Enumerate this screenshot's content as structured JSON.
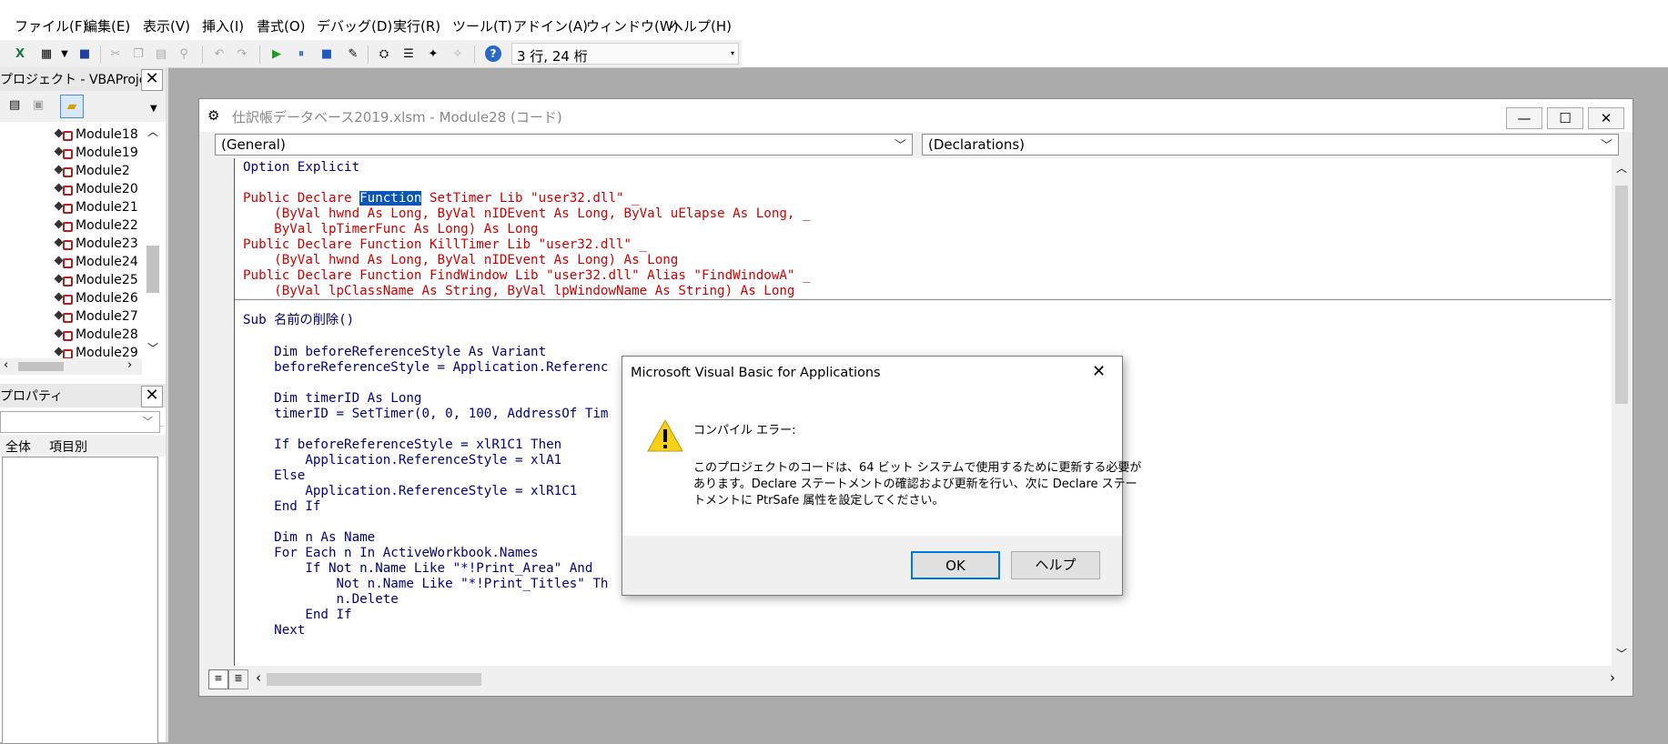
{
  "menu": [
    "ファイル(F)",
    "編集(E)",
    "表示(V)",
    "挿入(I)",
    "書式(O)",
    "デバッグ(D)",
    "実行(R)",
    "ツール(T)",
    "アドイン(A)",
    "ウィンドウ(W)",
    "ヘルプ(H)"
  ],
  "toolbar": {
    "cursor_position": "3 行, 24 桁"
  },
  "project_panel": {
    "title": "プロジェクト - VBAProject",
    "modules": [
      "Module18",
      "Module19",
      "Module2",
      "Module20",
      "Module21",
      "Module22",
      "Module23",
      "Module24",
      "Module25",
      "Module26",
      "Module27",
      "Module28",
      "Module29"
    ]
  },
  "properties_panel": {
    "title": "プロパティ",
    "tabs": [
      "全体",
      "項目別"
    ]
  },
  "code_window": {
    "title": "仕訳帳データベース2019.xlsm - Module28 (コード)",
    "object_combo": "(General)",
    "procedure_combo": "(Declarations)"
  },
  "code": {
    "l1": "Option Explicit",
    "l2_a": "Public Declare ",
    "l2_hl": "Function",
    "l2_b": " SetTimer Lib \"user32.dll\" _",
    "l3": "    (ByVal hwnd As Long, ByVal nIDEvent As Long, ByVal uElapse As Long, _",
    "l4": "    ByVal lpTimerFunc As Long) As Long",
    "l5": "Public Declare Function KillTimer Lib \"user32.dll\" _",
    "l6": "    (ByVal hwnd As Long, ByVal nIDEvent As Long) As Long",
    "l7": "Public Declare Function FindWindow Lib \"user32.dll\" Alias \"FindWindowA\" _",
    "l8": "    (ByVal lpClassName As String, ByVal lpWindowName As String) As Long",
    "l9": "Sub 名前の削除()",
    "l10": "    Dim beforeReferenceStyle As Variant",
    "l11": "    beforeReferenceStyle = Application.Referenc",
    "l12": "    Dim timerID As Long",
    "l13": "    timerID = SetTimer(0, 0, 100, AddressOf Tim",
    "l14": "    If beforeReferenceStyle = xlR1C1 Then",
    "l15": "        Application.ReferenceStyle = xlA1",
    "l16": "    Else",
    "l17": "        Application.ReferenceStyle = xlR1C1",
    "l18": "    End If",
    "l19": "    Dim n As Name",
    "l20": "    For Each n In ActiveWorkbook.Names",
    "l21": "        If Not n.Name Like \"*!Print_Area\" And",
    "l22": "            Not n.Name Like \"*!Print_Titles\" Th",
    "l23": "            n.Delete",
    "l24": "        End If",
    "l25": "    Next"
  },
  "dialog": {
    "title": "Microsoft Visual Basic for Applications",
    "heading": "コンパイル エラー:",
    "message_1": "このプロジェクトのコードは、64 ビット システムで使用するために更新する必要が",
    "message_2": "あります。Declare ステートメントの確認および更新を行い、次に Declare ステー",
    "message_3": "トメントに PtrSafe 属性を設定してください。",
    "ok_label": "OK",
    "help_label": "ヘルプ"
  },
  "colors": {
    "keyword": "#00007f",
    "error_red": "#d00000",
    "selection": "#0a56b8"
  }
}
